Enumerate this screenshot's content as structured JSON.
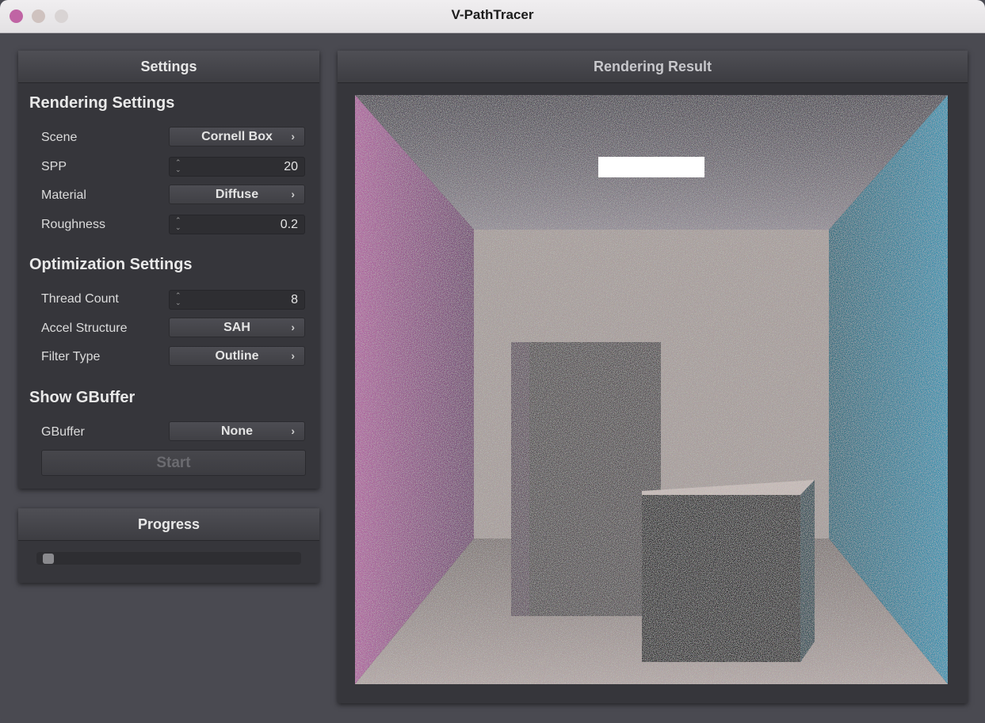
{
  "window": {
    "title": "V-PathTracer"
  },
  "settings": {
    "header": "Settings",
    "rendering": {
      "title": "Rendering Settings",
      "scene": {
        "label": "Scene",
        "value": "Cornell Box"
      },
      "spp": {
        "label": "SPP",
        "value": "20"
      },
      "material": {
        "label": "Material",
        "value": "Diffuse"
      },
      "roughness": {
        "label": "Roughness",
        "value": "0.2"
      }
    },
    "optimization": {
      "title": "Optimization Settings",
      "thread_count": {
        "label": "Thread Count",
        "value": "8"
      },
      "accel_structure": {
        "label": "Accel Structure",
        "value": "SAH"
      },
      "filter_type": {
        "label": "Filter Type",
        "value": "Outline"
      }
    },
    "gbuffer": {
      "title": "Show GBuffer",
      "gbuffer": {
        "label": "GBuffer",
        "value": "None"
      }
    },
    "start_label": "Start"
  },
  "progress": {
    "header": "Progress",
    "value": 0.0
  },
  "result": {
    "header": "Rendering Result"
  },
  "colors": {
    "left_wall": "#c05ea8",
    "right_wall": "#1fa2c2",
    "back_wall": "#b8aca8",
    "close_button": "#c064a4"
  },
  "icons": {
    "popup_arrow": "chevron-right-icon",
    "spin_arrows": "up-down-arrows-icon"
  }
}
